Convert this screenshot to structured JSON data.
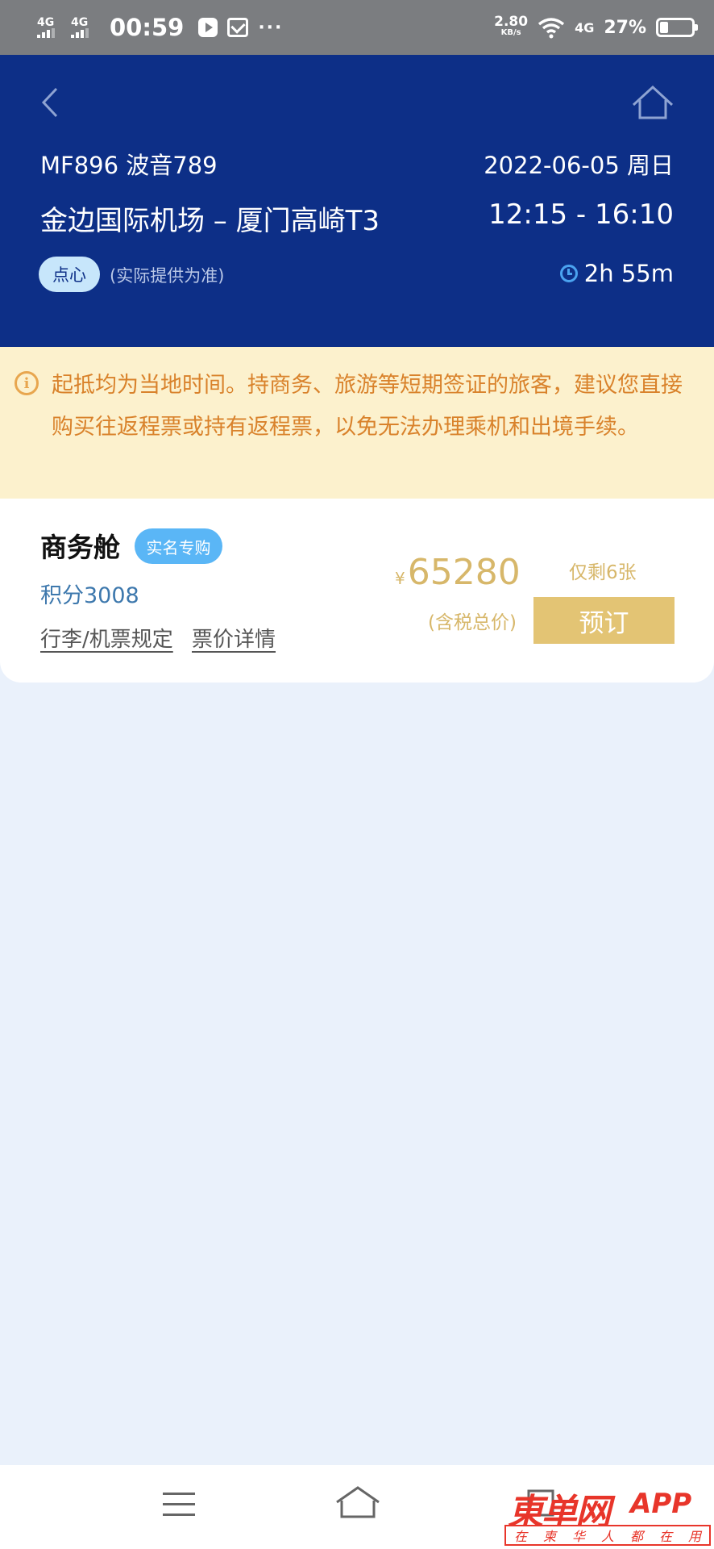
{
  "status_bar": {
    "net1": "4G",
    "net2": "4G",
    "time": "00:59",
    "more": "···",
    "speed_value": "2.80",
    "speed_unit": "KB/s",
    "net3": "4G",
    "battery_pct": "27%",
    "battery_level": 0.27
  },
  "header": {
    "flight_no": "MF896 波音789",
    "date": "2022-06-05 周日",
    "route": "金边国际机场 – 厦门高崎T3",
    "times": "12:15 - 16:10",
    "meal": "点心",
    "meal_note": "(实际提供为准)",
    "duration": "2h 55m"
  },
  "notice": {
    "text": "起抵均为当地时间。持商务、旅游等短期签证的旅客，建议您直接购买往返程票或持有返程票，以免无法办理乘机和出境手续。"
  },
  "fare": {
    "cabin": "商务舱",
    "badge": "实名专购",
    "points": "积分3008",
    "rules_link": "行李/机票规定",
    "detail_link": "票价详情",
    "currency": "¥",
    "price": "65280",
    "price_note": "(含税总价)",
    "remaining": "仅剩6张",
    "book_label": "预订"
  },
  "watermark": {
    "main": "東单网",
    "app": "APP",
    "sub": [
      "在",
      "柬",
      "华",
      "人",
      "都",
      "在",
      "用"
    ]
  },
  "colors": {
    "header_bg": "#0d2f87",
    "notice_bg": "#fcf1cd",
    "notice_text": "#d9822b",
    "price": "#d7b76a",
    "book_button": "#e3c474",
    "badge_blue": "#5ab6f6",
    "page_bg": "#eaf1fb"
  }
}
